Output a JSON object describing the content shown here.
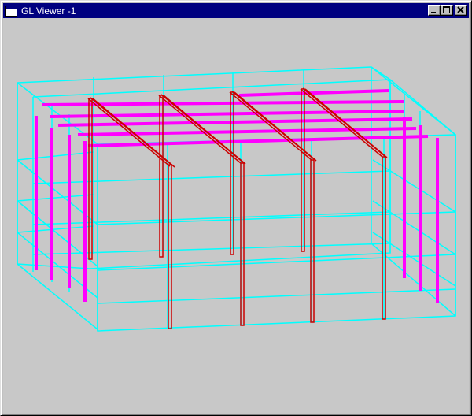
{
  "window": {
    "title": "GL Viewer -1",
    "controls": [
      "minimize",
      "maximize",
      "close"
    ]
  },
  "viewport": {
    "background": "#c8c8c8",
    "colors": {
      "wireframe": "#00ffff",
      "secondary_members": "#ff00ff",
      "primary_members": "#cc0000"
    },
    "icons": {
      "app": "window-icon",
      "minimize": "minimize-icon",
      "maximize": "maximize-icon",
      "close": "close-icon"
    }
  }
}
